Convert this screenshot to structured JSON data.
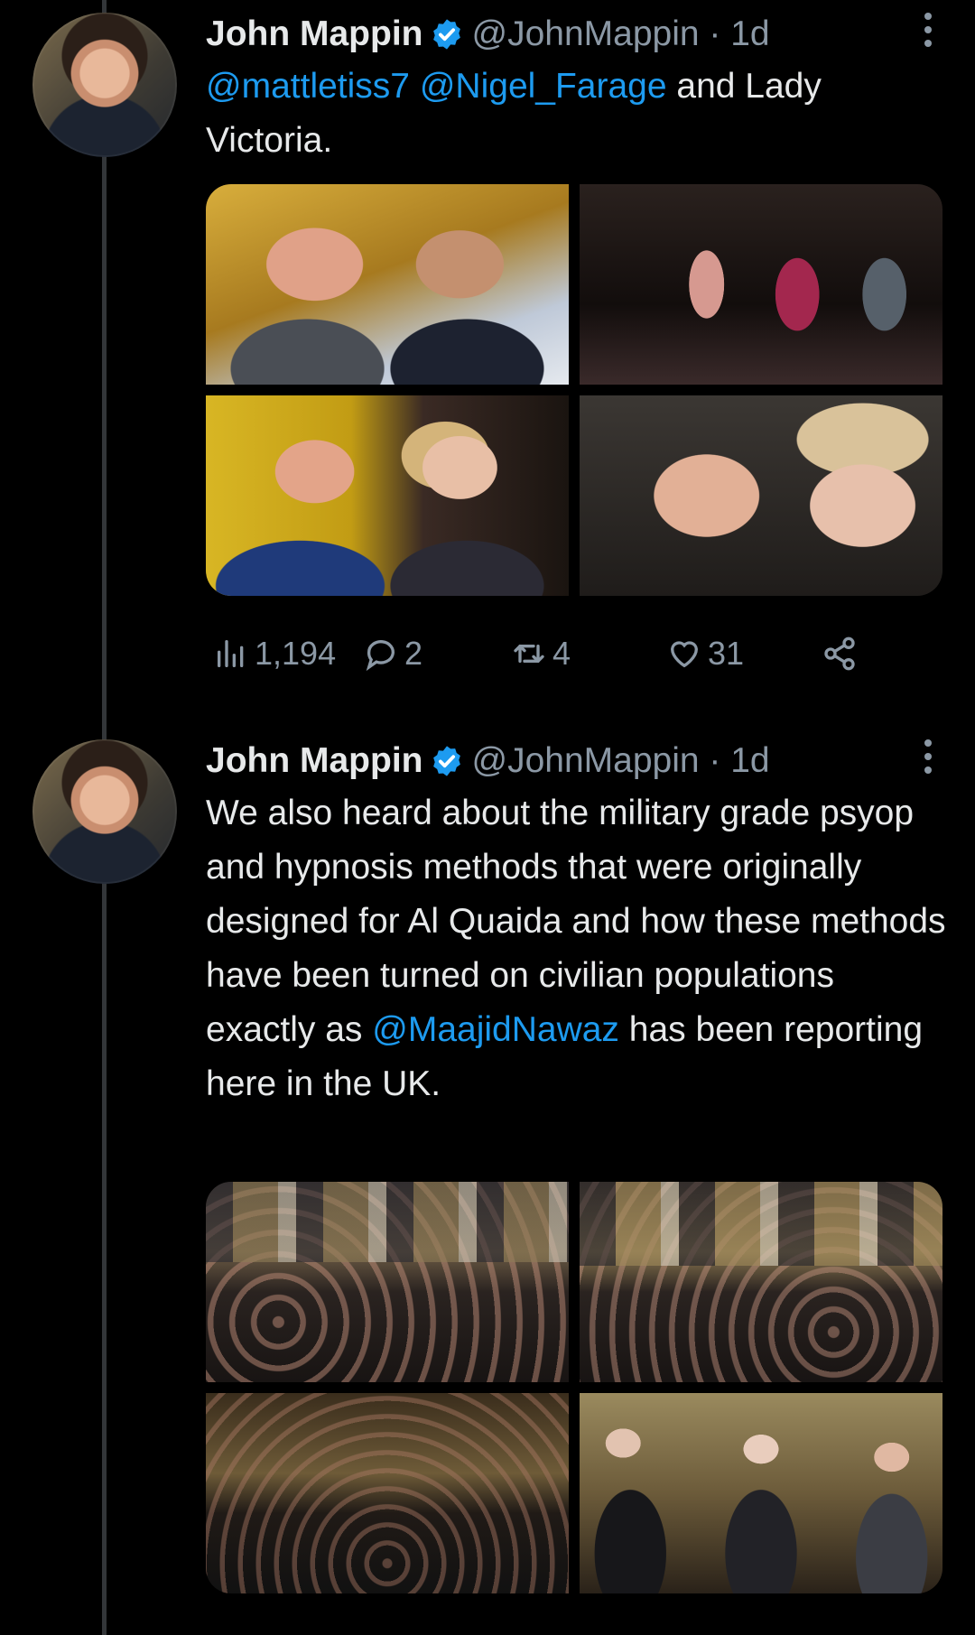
{
  "tweets": [
    {
      "name": "John Mappin",
      "handle": "@JohnMappin · 1d",
      "text_parts": [
        {
          "type": "mention",
          "text": "@mattletiss7"
        },
        {
          "type": "text",
          "text": " "
        },
        {
          "type": "mention",
          "text": "@Nigel_Farage"
        },
        {
          "type": "text",
          "text": " and Lady Victoria."
        }
      ],
      "images": [
        "photo-two-men-selfie",
        "photo-party-guests",
        "photo-farage-with-woman",
        "photo-couple-selfie"
      ],
      "actions": {
        "views": "1,194",
        "replies": "2",
        "retweets": "4",
        "likes": "31"
      }
    },
    {
      "name": "John Mappin",
      "handle": "@JohnMappin · 1d",
      "text_parts": [
        {
          "type": "text",
          "text": "We also heard about the military grade psyop and hypnosis methods that were originally designed for Al Quaida and how these methods have been turned on civilian populations exactly as "
        },
        {
          "type": "mention",
          "text": "@MaajidNawaz"
        },
        {
          "type": "text",
          "text": " has been reporting here in the UK."
        }
      ],
      "images": [
        "photo-crowd-hall-1",
        "photo-crowd-hall-2",
        "photo-crowd-hall-3",
        "photo-speakers"
      ]
    }
  ],
  "colors": {
    "background": "#000000",
    "text": "#e7e9ea",
    "secondary": "#8b98a5",
    "accent": "#1d9bf0",
    "thread_line": "#333639"
  },
  "icons": {
    "verified": "verified-badge-icon",
    "more": "more-options-icon",
    "views": "views-icon",
    "reply": "reply-icon",
    "retweet": "retweet-icon",
    "like": "like-icon",
    "share": "share-icon"
  }
}
